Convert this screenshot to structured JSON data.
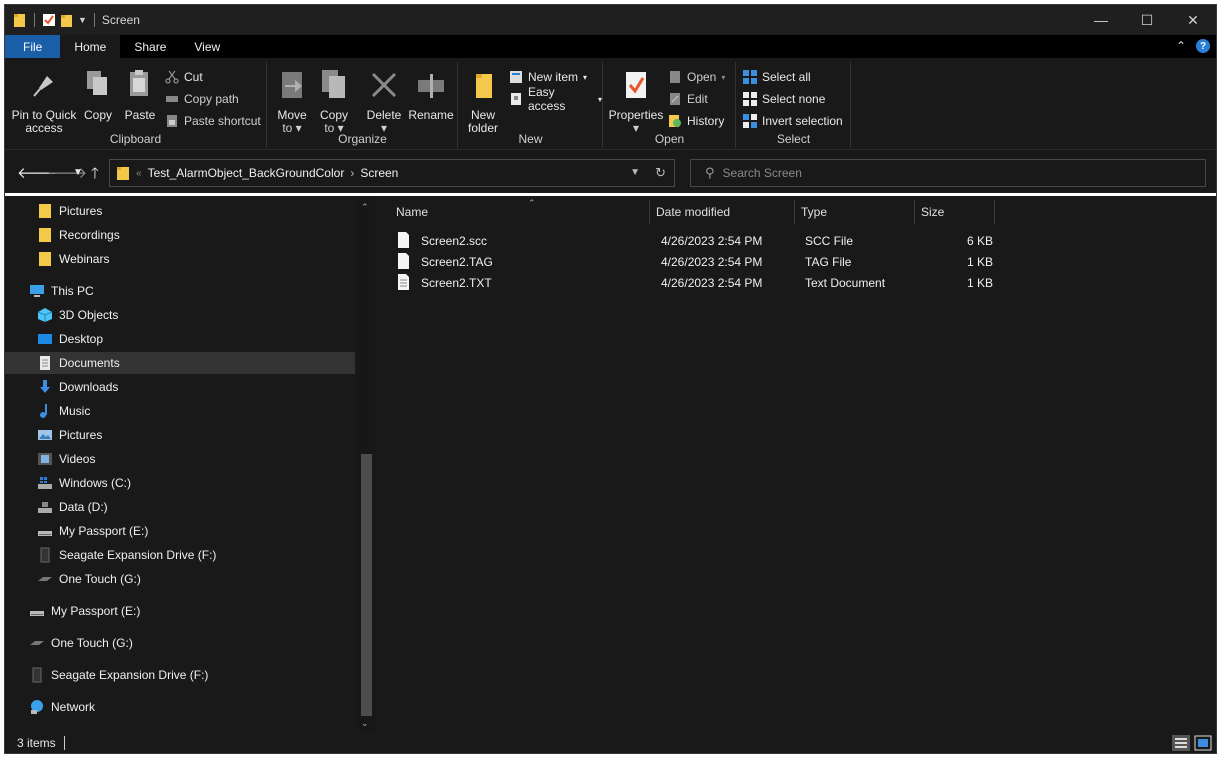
{
  "window": {
    "title": "Screen"
  },
  "window_controls": {
    "minimize": "—",
    "maximize": "☐",
    "close": "✕"
  },
  "tabs": [
    {
      "label": "File"
    },
    {
      "label": "Home"
    },
    {
      "label": "Share"
    },
    {
      "label": "View"
    }
  ],
  "ribbon": {
    "clipboard": {
      "label": "Clipboard",
      "pin": "Pin to Quick",
      "pin2": "access",
      "copy": "Copy",
      "paste": "Paste",
      "cut": "Cut",
      "copy_path": "Copy path",
      "paste_shortcut": "Paste shortcut"
    },
    "organize": {
      "label": "Organize",
      "move": "Move",
      "move2": "to",
      "copy": "Copy",
      "copy2": "to",
      "delete": "Delete",
      "rename": "Rename"
    },
    "new": {
      "label": "New",
      "new_folder": "New",
      "new_folder2": "folder",
      "new_item": "New item",
      "easy_access": "Easy access"
    },
    "open": {
      "label": "Open",
      "properties": "Properties",
      "open": "Open",
      "edit": "Edit",
      "history": "History"
    },
    "select": {
      "label": "Select",
      "select_all": "Select all",
      "select_none": "Select none",
      "invert": "Invert selection"
    }
  },
  "address": {
    "crumbs": [
      "Test_AlarmObject_BackGroundColor",
      "Screen"
    ],
    "search_placeholder": "Search Screen"
  },
  "nav_pane": {
    "items": [
      {
        "label": "Pictures",
        "icon": "folder-yellow-icon"
      },
      {
        "label": "Recordings",
        "icon": "folder-yellow-icon"
      },
      {
        "label": "Webinars",
        "icon": "folder-yellow-icon"
      },
      {
        "label": "This PC",
        "icon": "computer-icon"
      },
      {
        "label": "3D Objects",
        "icon": "cube-icon"
      },
      {
        "label": "Desktop",
        "icon": "desktop-icon"
      },
      {
        "label": "Documents",
        "icon": "document-icon"
      },
      {
        "label": "Downloads",
        "icon": "download-icon"
      },
      {
        "label": "Music",
        "icon": "music-icon"
      },
      {
        "label": "Pictures",
        "icon": "pictures-icon"
      },
      {
        "label": "Videos",
        "icon": "videos-icon"
      },
      {
        "label": "Windows (C:)",
        "icon": "drive-c-icon"
      },
      {
        "label": "Data (D:)",
        "icon": "drive-d-icon"
      },
      {
        "label": "My Passport (E:)",
        "icon": "usb-drive-icon"
      },
      {
        "label": "Seagate Expansion Drive (F:)",
        "icon": "external-drive-icon"
      },
      {
        "label": "One Touch (G:)",
        "icon": "portable-drive-icon"
      },
      {
        "label": "My Passport (E:)",
        "icon": "usb-drive-icon"
      },
      {
        "label": "One Touch (G:)",
        "icon": "portable-drive-icon"
      },
      {
        "label": "Seagate Expansion Drive (F:)",
        "icon": "external-drive-icon"
      },
      {
        "label": "Network",
        "icon": "network-icon"
      }
    ]
  },
  "file_list": {
    "columns": [
      "Name",
      "Date modified",
      "Type",
      "Size"
    ],
    "rows": [
      {
        "name": "Screen2.scc",
        "date": "4/26/2023 2:54 PM",
        "type": "SCC File",
        "size": "6 KB"
      },
      {
        "name": "Screen2.TAG",
        "date": "4/26/2023 2:54 PM",
        "type": "TAG File",
        "size": "1 KB"
      },
      {
        "name": "Screen2.TXT",
        "date": "4/26/2023 2:54 PM",
        "type": "Text Document",
        "size": "1 KB"
      }
    ]
  },
  "status": {
    "count": "3 items"
  },
  "colors": {
    "accent": "#1a5ea8",
    "background": "#191919",
    "folder": "#f3c84b"
  }
}
